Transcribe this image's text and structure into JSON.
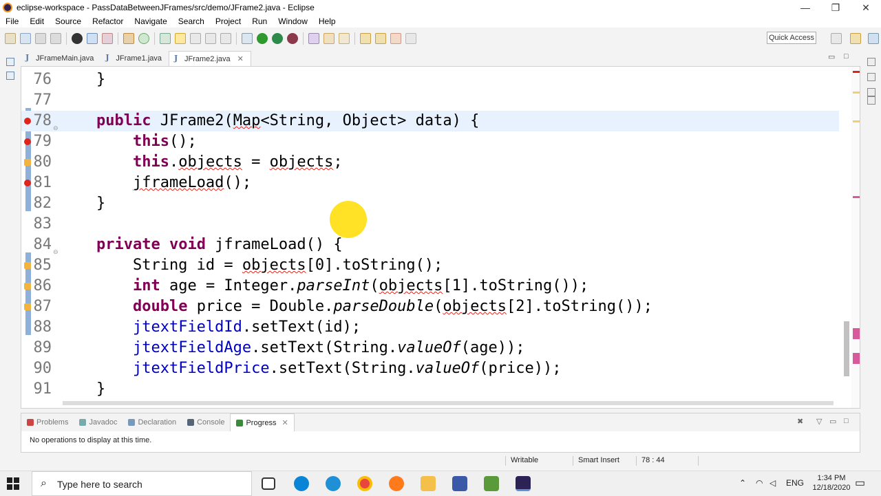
{
  "window": {
    "title": "eclipse-workspace - PassDataBetweenJFrames/src/demo/JFrame2.java - Eclipse",
    "minimize_glyph": "—",
    "restore_glyph": "❐",
    "close_glyph": "✕"
  },
  "menu": [
    "File",
    "Edit",
    "Source",
    "Refactor",
    "Navigate",
    "Search",
    "Project",
    "Run",
    "Window",
    "Help"
  ],
  "toolbar": {
    "quick_access": "Quick Access"
  },
  "editor_tabs": [
    {
      "label": "JFrameMain.java",
      "active": false
    },
    {
      "label": "JFrame1.java",
      "active": false
    },
    {
      "label": "JFrame2.java",
      "active": true
    }
  ],
  "editor_tab_close": "✕",
  "code_lines": [
    {
      "n": "76",
      "text": "    }"
    },
    {
      "n": "77",
      "text": ""
    },
    {
      "n": "78",
      "text": "    public JFrame2(Map<String, Object> data) {"
    },
    {
      "n": "79",
      "text": "        this();"
    },
    {
      "n": "80",
      "text": "        this.objects = objects;"
    },
    {
      "n": "81",
      "text": "        jframeLoad();"
    },
    {
      "n": "82",
      "text": "    }"
    },
    {
      "n": "83",
      "text": ""
    },
    {
      "n": "84",
      "text": "    private void jframeLoad() {"
    },
    {
      "n": "85",
      "text": "        String id = objects[0].toString();"
    },
    {
      "n": "86",
      "text": "        int age = Integer.parseInt(objects[1].toString());"
    },
    {
      "n": "87",
      "text": "        double price = Double.parseDouble(objects[2].toString());"
    },
    {
      "n": "88",
      "text": "        jtextFieldId.setText(id);"
    },
    {
      "n": "89",
      "text": "        jtextFieldAge.setText(String.valueOf(age));"
    },
    {
      "n": "90",
      "text": "        jtextFieldPrice.setText(String.valueOf(price));"
    },
    {
      "n": "91",
      "text": "    }"
    }
  ],
  "panel": {
    "tabs": [
      {
        "label": "Problems",
        "active": false,
        "color": "#c44"
      },
      {
        "label": "Javadoc",
        "active": false,
        "color": "#7aa"
      },
      {
        "label": "Declaration",
        "active": false,
        "color": "#79b"
      },
      {
        "label": "Console",
        "active": false,
        "color": "#567"
      },
      {
        "label": "Progress",
        "active": true,
        "color": "#3a8a3a"
      }
    ],
    "message": "No operations to display at this time."
  },
  "status": {
    "writable": "Writable",
    "insert_mode": "Smart Insert",
    "position": "78 : 44"
  },
  "taskbar": {
    "search_placeholder": "Type here to search",
    "tray_lang": "ENG",
    "time": "1:34 PM",
    "date": "12/18/2020"
  },
  "colors": {
    "keyword": "#7f0055",
    "field": "#0000c0",
    "error": "#e0241c",
    "current_line": "#e8f2fe"
  }
}
